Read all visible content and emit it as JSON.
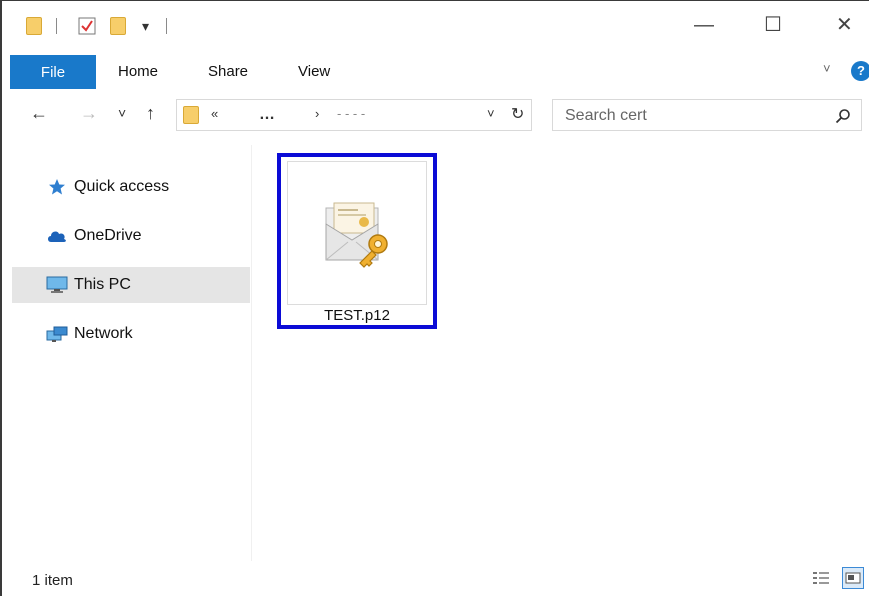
{
  "title_bar": {
    "minimize_glyph": "—",
    "maximize_glyph": "☐",
    "close_glyph": "✕",
    "qa_menu_glyph": "▾"
  },
  "ribbon": {
    "tabs": [
      "File",
      "Home",
      "Share",
      "View"
    ],
    "collapse_glyph": "˅",
    "help_glyph": "?"
  },
  "address_bar": {
    "back_glyph": "←",
    "forward_glyph": "→",
    "recent_glyph": "˅",
    "up_glyph": "↑",
    "crumb_overflow": "«",
    "crumb_ellipsis": "…",
    "crumb_separator": "›",
    "crumb_current": "- - - -",
    "dropdown_glyph": "˅",
    "refresh_glyph": "↻"
  },
  "search": {
    "placeholder": "Search cert"
  },
  "nav_pane": {
    "items": [
      {
        "label": "Quick access",
        "icon": "star-icon"
      },
      {
        "label": "OneDrive",
        "icon": "cloud-icon"
      },
      {
        "label": "This PC",
        "icon": "computer-icon",
        "selected": true
      },
      {
        "label": "Network",
        "icon": "network-icon"
      }
    ]
  },
  "content": {
    "files": [
      {
        "name": "TEST.p12",
        "icon": "certificate-file-icon",
        "selected": true
      }
    ]
  },
  "status_bar": {
    "item_count": "1 item"
  },
  "colors": {
    "accent": "#1979ca",
    "highlight_border": "#0b0bd6",
    "nav_selected": "#e5e5e5",
    "folder": "#f7ce6a"
  }
}
